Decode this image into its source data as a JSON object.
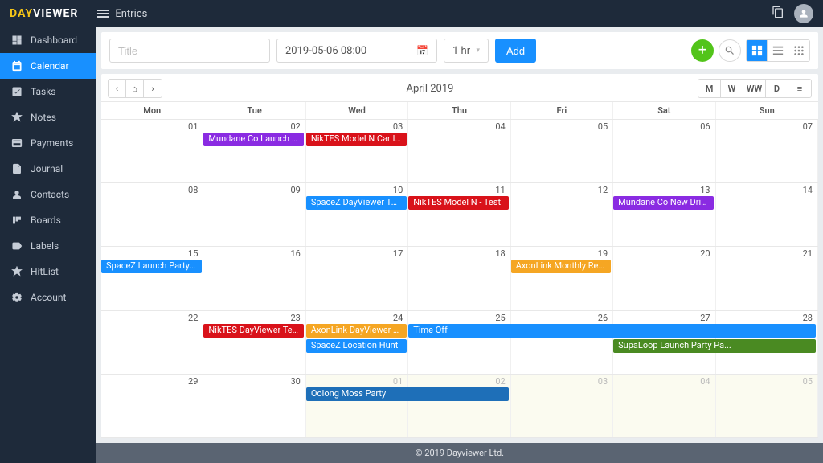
{
  "brand": {
    "day": "DAY",
    "viewer": "VIEWER"
  },
  "topbar": {
    "entries_label": "Entries"
  },
  "sidebar": {
    "items": [
      {
        "name": "dashboard",
        "label": "Dashboard"
      },
      {
        "name": "calendar",
        "label": "Calendar",
        "active": true
      },
      {
        "name": "tasks",
        "label": "Tasks"
      },
      {
        "name": "notes",
        "label": "Notes"
      },
      {
        "name": "payments",
        "label": "Payments"
      },
      {
        "name": "journal",
        "label": "Journal"
      },
      {
        "name": "contacts",
        "label": "Contacts"
      },
      {
        "name": "boards",
        "label": "Boards"
      },
      {
        "name": "labels",
        "label": "Labels"
      },
      {
        "name": "hitlist",
        "label": "HitList"
      },
      {
        "name": "account",
        "label": "Account"
      }
    ]
  },
  "toolbar": {
    "title_placeholder": "Title",
    "date_value": "2019-05-06 08:00",
    "duration_value": "1 hr",
    "add_label": "Add"
  },
  "calendar": {
    "title": "April 2019",
    "view_buttons": [
      "M",
      "W",
      "WW",
      "D",
      "≡"
    ],
    "dow": [
      "Mon",
      "Tue",
      "Wed",
      "Thu",
      "Fri",
      "Sat",
      "Sun"
    ],
    "weeks": [
      [
        {
          "n": "01"
        },
        {
          "n": "02"
        },
        {
          "n": "03"
        },
        {
          "n": "04"
        },
        {
          "n": "05"
        },
        {
          "n": "06"
        },
        {
          "n": "07"
        }
      ],
      [
        {
          "n": "08"
        },
        {
          "n": "09"
        },
        {
          "n": "10"
        },
        {
          "n": "11"
        },
        {
          "n": "12"
        },
        {
          "n": "13"
        },
        {
          "n": "14"
        }
      ],
      [
        {
          "n": "15"
        },
        {
          "n": "16"
        },
        {
          "n": "17"
        },
        {
          "n": "18"
        },
        {
          "n": "19"
        },
        {
          "n": "20"
        },
        {
          "n": "21"
        }
      ],
      [
        {
          "n": "22"
        },
        {
          "n": "23"
        },
        {
          "n": "24"
        },
        {
          "n": "25"
        },
        {
          "n": "26"
        },
        {
          "n": "27"
        },
        {
          "n": "28"
        }
      ],
      [
        {
          "n": "29"
        },
        {
          "n": "30"
        },
        {
          "n": "01",
          "other": true
        },
        {
          "n": "02",
          "other": true
        },
        {
          "n": "03",
          "other": true
        },
        {
          "n": "04",
          "other": true
        },
        {
          "n": "05",
          "other": true
        }
      ]
    ],
    "events": [
      {
        "week": 0,
        "start": 1,
        "span": 1,
        "row": 0,
        "label": "Mundane Co Launch Party ...",
        "color": "#8a2be2"
      },
      {
        "week": 0,
        "start": 2,
        "span": 1,
        "row": 0,
        "label": "NikTES Model N Car Ideas",
        "color": "#d9121a"
      },
      {
        "week": 1,
        "start": 2,
        "span": 1,
        "row": 0,
        "label": "SpaceZ DayViewer Team Ro...",
        "color": "#1890ff"
      },
      {
        "week": 1,
        "start": 3,
        "span": 1,
        "row": 0,
        "label": "NikTES Model N - Test",
        "color": "#d9121a"
      },
      {
        "week": 1,
        "start": 5,
        "span": 1,
        "row": 0,
        "label": "Mundane Co New Drill Bit",
        "color": "#8a2be2"
      },
      {
        "week": 2,
        "start": 0,
        "span": 1,
        "row": 0,
        "label": "SpaceZ Launch Party Paym...",
        "color": "#1890ff"
      },
      {
        "week": 2,
        "start": 4,
        "span": 1,
        "row": 0,
        "label": "AxonLink Monthly Report",
        "color": "#f5a623"
      },
      {
        "week": 3,
        "start": 1,
        "span": 1,
        "row": 0,
        "label": "NikTES DayViewer Team Room",
        "color": "#d9121a"
      },
      {
        "week": 3,
        "start": 2,
        "span": 1,
        "row": 0,
        "label": "AxonLink DayViewer Team ...",
        "color": "#f5a623"
      },
      {
        "week": 3,
        "start": 2,
        "span": 1,
        "row": 1,
        "label": "SpaceZ Location Hunt",
        "color": "#1890ff"
      },
      {
        "week": 3,
        "start": 3,
        "span": 4,
        "row": 0,
        "label": "Time Off",
        "color": "#1890ff"
      },
      {
        "week": 3,
        "start": 5,
        "span": 2,
        "row": 1,
        "label": "SupaLoop Launch Party Pa...",
        "color": "#4a8a22"
      },
      {
        "week": 4,
        "start": 2,
        "span": 2,
        "row": 0,
        "label": "Oolong Moss Party",
        "color": "#1e6fb8"
      }
    ]
  },
  "footer": {
    "text": "© 2019 Dayviewer Ltd."
  }
}
